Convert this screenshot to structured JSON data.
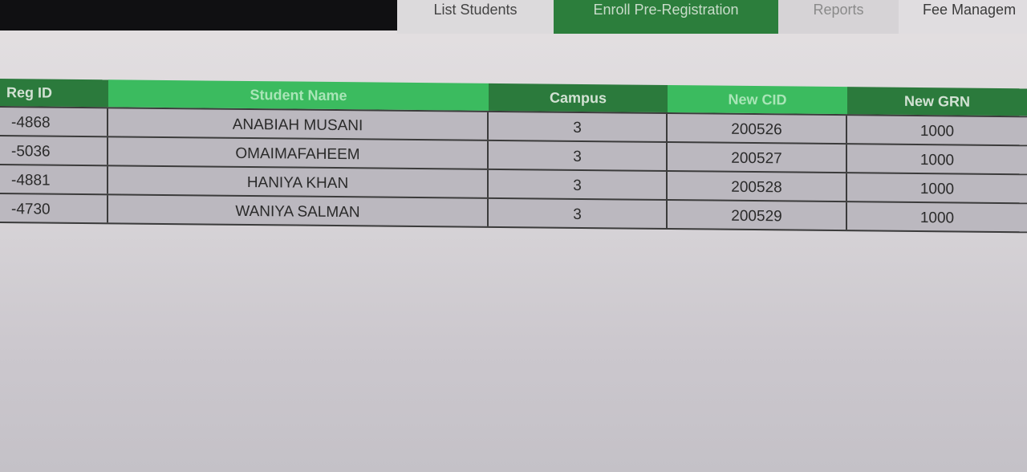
{
  "tabs": [
    {
      "label": "List Students"
    },
    {
      "label": "Enroll Pre-Registration"
    },
    {
      "label": "Reports"
    },
    {
      "label": "Fee Managem"
    }
  ],
  "table": {
    "columns": [
      "Reg ID",
      "Student Name",
      "Campus",
      "New CID",
      "New GRN"
    ],
    "rows": [
      [
        "-4868",
        "ANABIAH MUSANI",
        "3",
        "200526",
        "1000"
      ],
      [
        "-5036",
        "OMAIMAFAHEEM",
        "3",
        "200527",
        "1000"
      ],
      [
        "-4881",
        "HANIYA KHAN",
        "3",
        "200528",
        "1000"
      ],
      [
        "-4730",
        "WANIYA SALMAN",
        "3",
        "200529",
        "1000"
      ]
    ]
  },
  "colors": {
    "header_dark": "#2b7a3c",
    "header_light": "#3bbb5f",
    "tab_active": "#2c7e3c"
  }
}
